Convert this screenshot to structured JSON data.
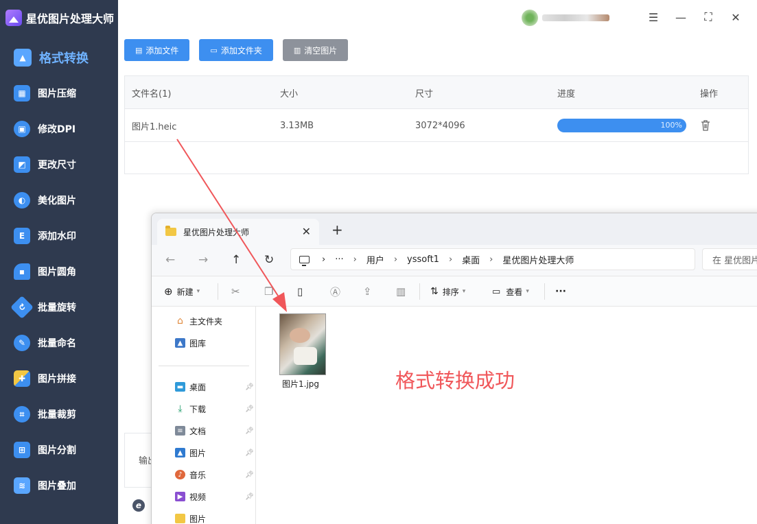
{
  "app": {
    "title": "星优图片处理大师"
  },
  "sidebar": {
    "items": [
      {
        "label": "格式转换",
        "icon": "image-convert-icon",
        "color": "#3d8ff0"
      },
      {
        "label": "图片压缩",
        "icon": "compress-icon",
        "color": "#3d8ff0"
      },
      {
        "label": "修改DPI",
        "icon": "dpi-icon",
        "color": "#3d8ff0"
      },
      {
        "label": "更改尺寸",
        "icon": "resize-icon",
        "color": "#3d8ff0"
      },
      {
        "label": "美化图片",
        "icon": "beautify-icon",
        "color": "#3d8ff0"
      },
      {
        "label": "添加水印",
        "icon": "watermark-icon",
        "color": "#3d8ff0"
      },
      {
        "label": "图片圆角",
        "icon": "round-corner-icon",
        "color": "#3d8ff0"
      },
      {
        "label": "批量旋转",
        "icon": "rotate-icon",
        "color": "#3d8ff0"
      },
      {
        "label": "批量命名",
        "icon": "rename-icon",
        "color": "#3d8ff0"
      },
      {
        "label": "图片拼接",
        "icon": "stitch-icon",
        "color": "#3d8ff0"
      },
      {
        "label": "批量裁剪",
        "icon": "crop-icon",
        "color": "#3d8ff0"
      },
      {
        "label": "图片分割",
        "icon": "split-icon",
        "color": "#3d8ff0"
      },
      {
        "label": "图片叠加",
        "icon": "layers-icon",
        "color": "#3d8ff0"
      }
    ]
  },
  "toolbar": {
    "add_file": "添加文件",
    "add_folder": "添加文件夹",
    "clear_images": "清空图片"
  },
  "table": {
    "headers": {
      "filename": "文件名(1)",
      "size": "大小",
      "dimensions": "尺寸",
      "progress": "进度",
      "actions": "操作"
    },
    "rows": [
      {
        "filename": "图片1.heic",
        "size": "3.13MB",
        "dimensions": "3072*4096",
        "progress_label": "100%",
        "progress": 1.0
      }
    ]
  },
  "output": {
    "label": "输出",
    "bottom_icon_letter": "e"
  },
  "explorer": {
    "tab_title": "星优图片处理大师",
    "breadcrumb": [
      "用户",
      "yssoft1",
      "桌面",
      "星优图片处理大师"
    ],
    "ellipsis": "···",
    "search_placeholder": "在 星优图片",
    "commands": {
      "new": "新建",
      "sort": "排序",
      "view": "查看",
      "more": "···"
    },
    "nav": {
      "home": "主文件夹",
      "gallery": "图库",
      "pinned": [
        {
          "label": "桌面",
          "icon": "desktop-icon"
        },
        {
          "label": "下载",
          "icon": "download-icon"
        },
        {
          "label": "文档",
          "icon": "document-icon"
        },
        {
          "label": "图片",
          "icon": "pictures-icon"
        },
        {
          "label": "音乐",
          "icon": "music-icon"
        },
        {
          "label": "视频",
          "icon": "video-icon"
        },
        {
          "label": "图片",
          "icon": "folder-icon"
        }
      ]
    },
    "file": {
      "name": "图片1.jpg"
    }
  },
  "annotation": {
    "text": "格式转换成功",
    "color": "#f0575a"
  }
}
